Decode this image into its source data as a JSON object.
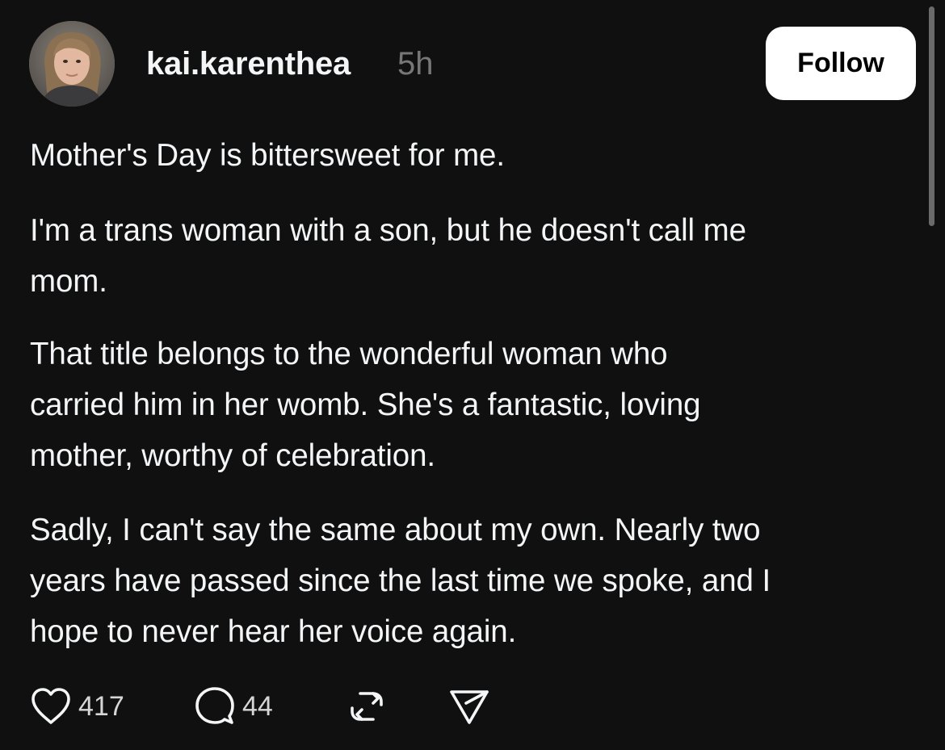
{
  "post": {
    "author": {
      "username": "kai.karenthea",
      "avatar_icon": "profile-photo"
    },
    "timestamp": "5h",
    "follow_label": "Follow",
    "paragraphs": [
      "Mother's Day is bittersweet for me.",
      "I'm a trans woman with a son, but he doesn't call me\nmom.",
      "That title belongs to the wonderful woman who\ncarried him in her womb. She's a fantastic, loving\nmother, worthy of celebration.",
      "Sadly, I can't say the same about my own. Nearly two\nyears have passed since the last time we spoke, and I\nhope to never hear her voice again."
    ],
    "actions": {
      "like": {
        "icon": "heart-icon",
        "count": "417"
      },
      "reply": {
        "icon": "comment-icon",
        "count": "44"
      },
      "repost": {
        "icon": "repost-icon"
      },
      "share": {
        "icon": "send-icon"
      }
    }
  },
  "colors": {
    "background": "#101010",
    "text": "#f3f5f7",
    "muted": "#777777",
    "button_bg": "#ffffff",
    "button_text": "#000000"
  }
}
